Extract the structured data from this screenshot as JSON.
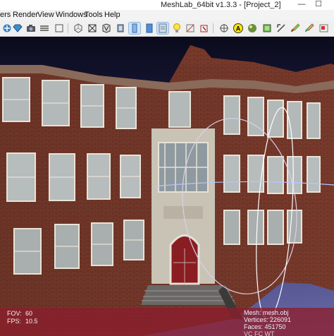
{
  "window": {
    "title": "MeshLab_64bit v1.3.3 - [Project_2]",
    "minimize_glyph": "—",
    "maximize_glyph": "☐"
  },
  "menubar": {
    "items": [
      "ers",
      "Render",
      "View",
      "Windows",
      "Tools",
      "Help"
    ]
  },
  "toolbar": {
    "icons": [
      "navigate-icon",
      "gem-icon",
      "snapshot-icon",
      "layers-icon",
      "bounding-box-icon",
      "points-icon",
      "wireframe-icon",
      "hidden-lines-icon",
      "flat-shading-icon",
      "smooth-shading-icon",
      "texture-icon",
      "light-bulb-icon",
      "backface-icon",
      "color-pick-icon",
      "crosshair-icon",
      "annotate-icon",
      "align-icon",
      "measure-icon",
      "paint-brush-icon",
      "cube-select-icon"
    ]
  },
  "viewport": {
    "background_top": "#0b0b1c",
    "background_bottom": "#6c6caa",
    "info_left": {
      "fov_label": "FOV:",
      "fov_value": "60",
      "fps_label": "FPS:",
      "fps_value": "10.5"
    },
    "info_right": {
      "mesh_label": "Mesh:",
      "mesh_value": "mesh.obj",
      "vertices_label": "Vertices:",
      "vertices_value": "226091",
      "faces_label": "Faces:",
      "faces_value": "451750",
      "extra": "VC FC WT"
    },
    "overlay_color": "#8c1e2d"
  }
}
